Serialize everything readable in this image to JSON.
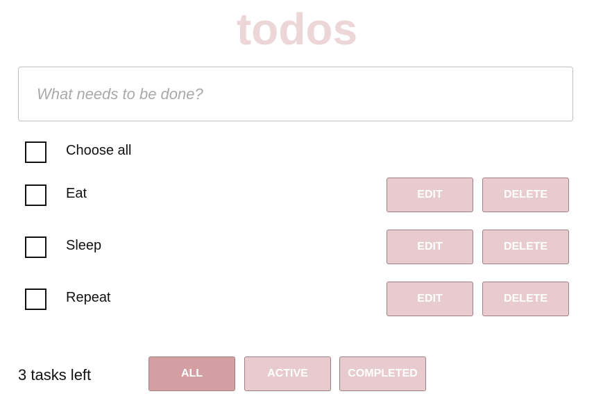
{
  "header": {
    "title": "todos"
  },
  "new_todo": {
    "placeholder": "What needs to be done?",
    "value": ""
  },
  "choose_all": {
    "label": "Choose all",
    "checked": false
  },
  "todos": [
    {
      "label": "Eat",
      "checked": false,
      "edit_label": "EDIT",
      "delete_label": "DELETE"
    },
    {
      "label": "Sleep",
      "checked": false,
      "edit_label": "EDIT",
      "delete_label": "DELETE"
    },
    {
      "label": "Repeat",
      "checked": false,
      "edit_label": "EDIT",
      "delete_label": "DELETE"
    }
  ],
  "footer": {
    "tasks_left": "3 tasks left",
    "filters": [
      {
        "label": "ALL",
        "selected": true
      },
      {
        "label": "ACTIVE",
        "selected": false
      },
      {
        "label": "COMPLETED",
        "selected": false
      }
    ]
  },
  "colors": {
    "title": "#ecd6d8",
    "button_bg": "#e8cbce",
    "button_selected_bg": "#d49fa2",
    "button_text": "#ffffff"
  }
}
